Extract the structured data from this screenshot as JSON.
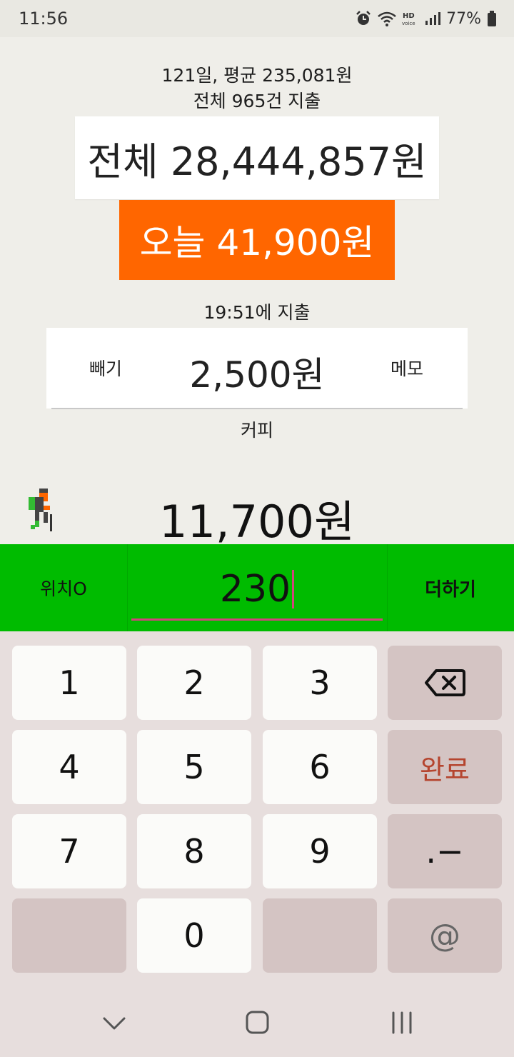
{
  "status_bar": {
    "time": "11:56",
    "battery": "77%",
    "icons": [
      "alarm-icon",
      "wifi-icon",
      "hd-voice-icon",
      "signal-icon",
      "battery-icon"
    ]
  },
  "summary": {
    "days_avg": "121일, 평균 235,081원",
    "count": "전체 965건 지출",
    "total": "전체 28,444,857원",
    "today": "오늘 41,900원"
  },
  "last_expense": {
    "time_label": "19:51에 지출",
    "subtract_label": "빼기",
    "amount": "2,500원",
    "memo_label": "메모",
    "memo": "커피"
  },
  "running_total": "11,700원",
  "input_bar": {
    "left_label": "위치O",
    "value": "230",
    "add_label": "더하기"
  },
  "keypad": {
    "row1": [
      "1",
      "2",
      "3"
    ],
    "row2": [
      "4",
      "5",
      "6"
    ],
    "done_label": "완료",
    "row3": [
      "7",
      "8",
      "9"
    ],
    "dot_minus": ".−",
    "zero": "0",
    "at": "@"
  },
  "colors": {
    "today_orange": "#ff6600",
    "input_green": "#00bb00",
    "caret_pink": "#d0457c",
    "done_red": "#b5452f"
  }
}
